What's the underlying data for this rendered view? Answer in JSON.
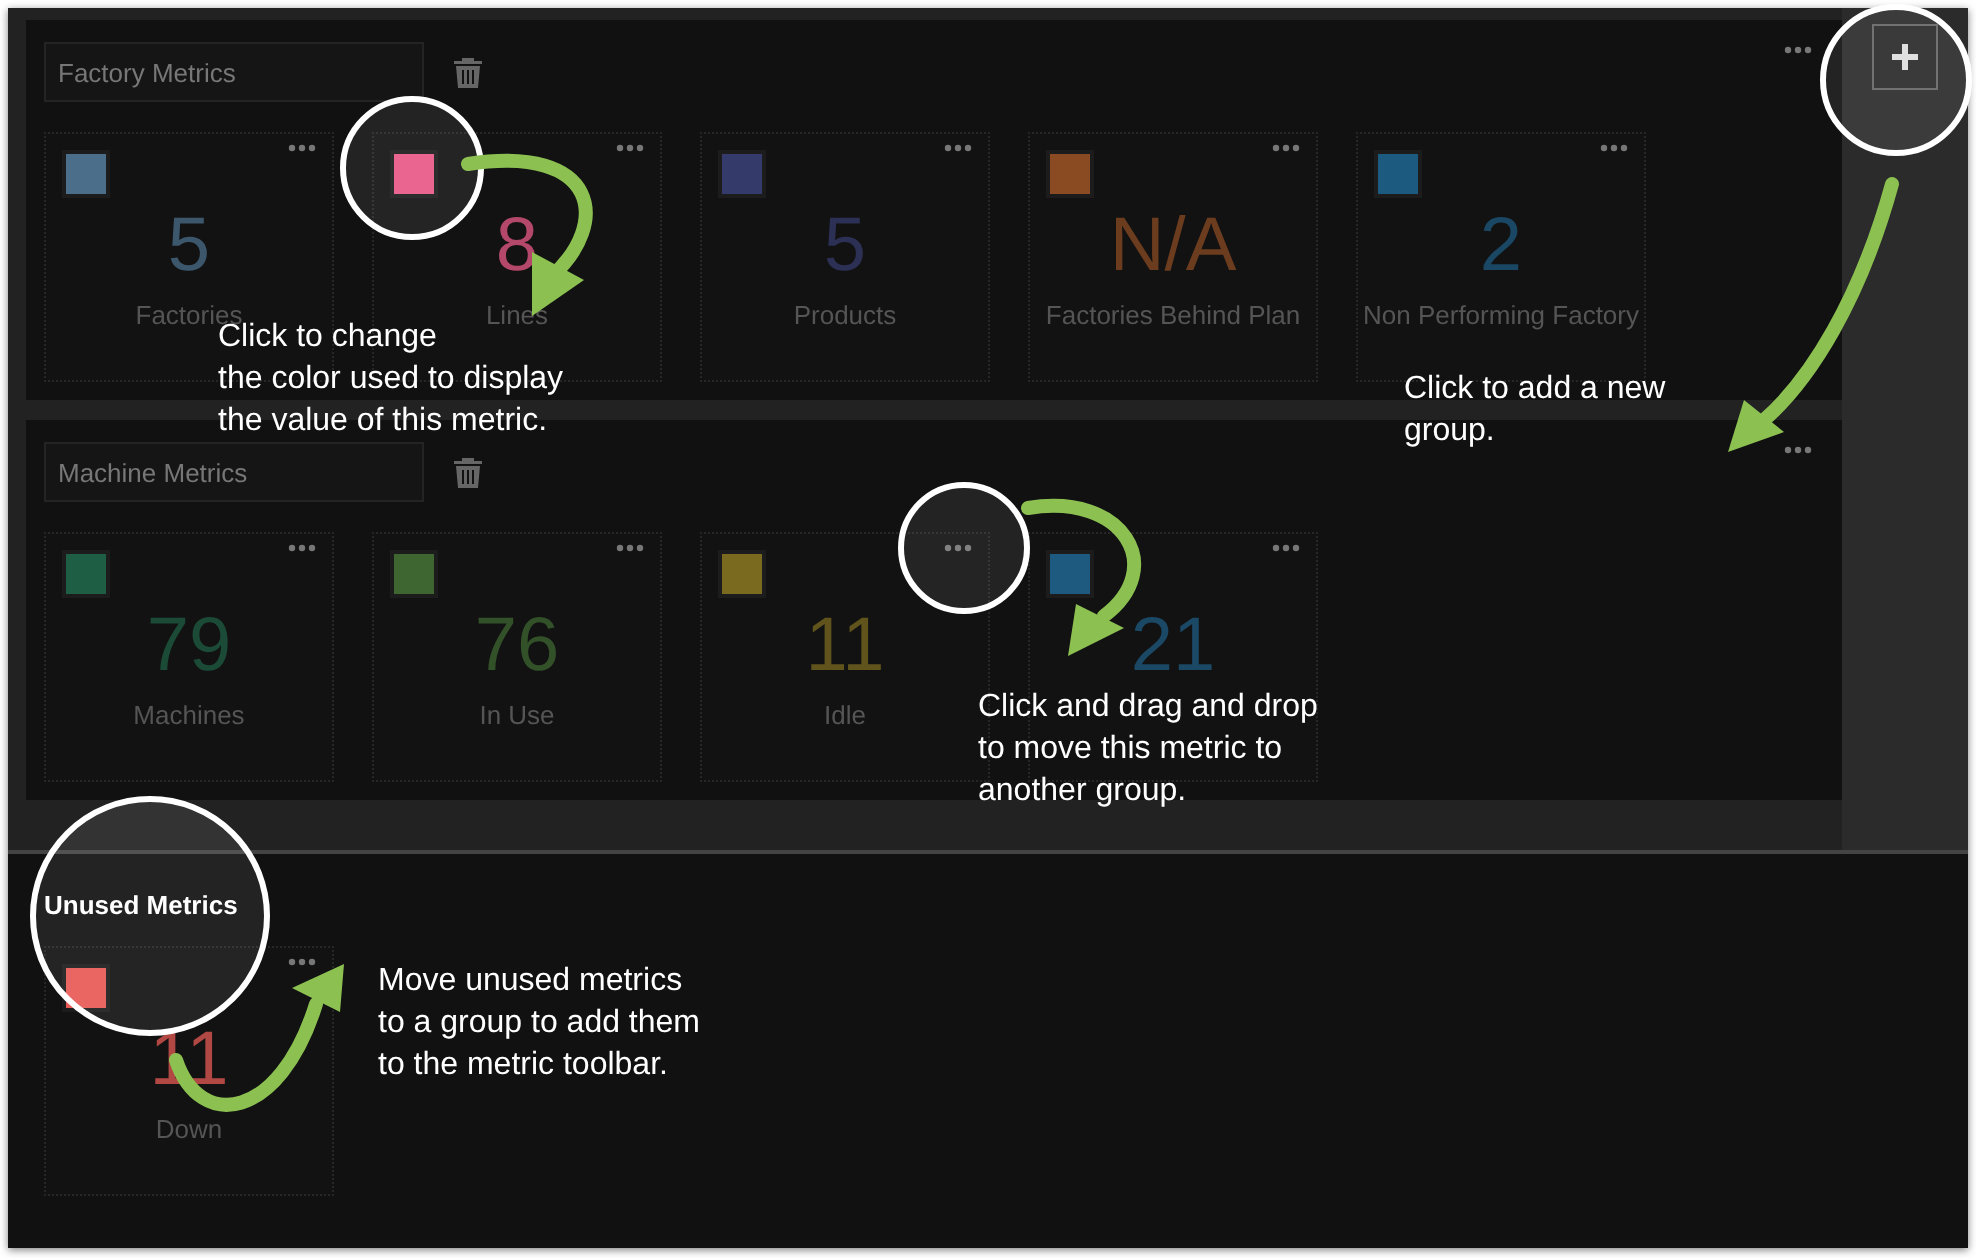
{
  "groups": [
    {
      "title": "Factory Metrics",
      "metrics": [
        {
          "value": "5",
          "label": "Factories",
          "color": "#4b6e8b"
        },
        {
          "value": "8",
          "label": "Lines",
          "color": "#e95a88"
        },
        {
          "value": "5",
          "label": "Products",
          "color": "#343a6a"
        },
        {
          "value": "N/A",
          "label": "Factories Behind Plan",
          "color": "#8a4a22"
        },
        {
          "value": "2",
          "label": "Non Performing Factory",
          "color": "#1d5a80"
        }
      ]
    },
    {
      "title": "Machine Metrics",
      "metrics": [
        {
          "value": "79",
          "label": "Machines",
          "color": "#1e5e44"
        },
        {
          "value": "76",
          "label": "In Use",
          "color": "#3e6630"
        },
        {
          "value": "11",
          "label": "Idle",
          "color": "#7a6a20"
        },
        {
          "value": "21",
          "color": "#1e5a80"
        }
      ]
    }
  ],
  "unused": {
    "title": "Unused Metrics",
    "metrics": [
      {
        "value": "11",
        "label": "Down",
        "color": "#e85a55"
      }
    ]
  },
  "annotations": [
    {
      "text": "Click to change\nthe color used to display\nthe value of this metric."
    },
    {
      "text": "Click to add a new\ngroup."
    },
    {
      "text": "Click and drag and drop\nto move this metric to\nanother group."
    },
    {
      "text": "Move unused metrics\nto a group to add them\nto the metric toolbar."
    }
  ]
}
